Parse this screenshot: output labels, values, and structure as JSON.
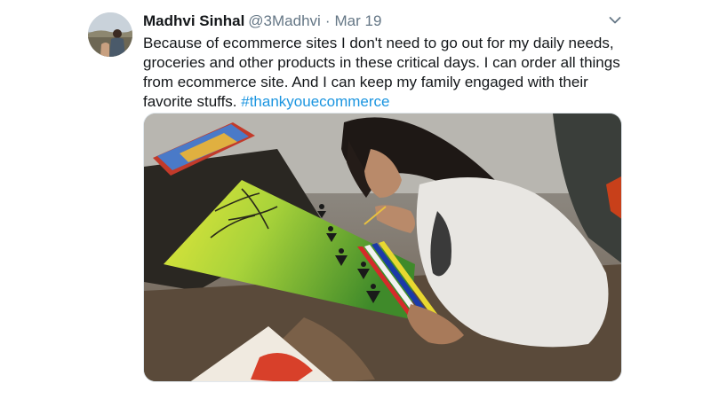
{
  "tweet": {
    "display_name": "Madhvi Sinhal",
    "handle": "@3Madhvi",
    "separator": "·",
    "date": "Mar 19",
    "text": "Because of ecommerce sites I don't need to go out for my daily needs, groceries and other products in these critical days. I can order all things from ecommerce site. And I can keep my family engaged with their favorite stuffs.",
    "hashtag": "#thankyouecommerce",
    "menu_icon": "chevron-down-icon",
    "avatar_icon": "user-avatar-photo",
    "media_icon": "photo-girl-painting-canvas"
  },
  "colors": {
    "name": "#14171a",
    "secondary": "#657786",
    "link": "#1b95e0",
    "border": "#e1e8ed"
  }
}
